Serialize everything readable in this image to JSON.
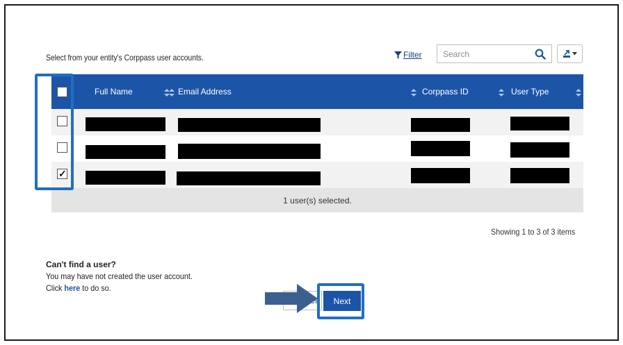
{
  "intro": {
    "prefix": "Select from your entity's",
    "brand": "Corppass",
    "suffix": "user accounts."
  },
  "toolbar": {
    "filter_label": "Filter",
    "search_placeholder": "Search",
    "search_value": "",
    "search_icon": "magnifier-icon",
    "export_icon": "export-icon",
    "dropdown_icon": "caret-down-icon"
  },
  "table": {
    "headers": {
      "full_name": "Full Name",
      "email": "Email Address",
      "corppass_id": "Corppass ID",
      "user_type": "User Type"
    },
    "rows": [
      {
        "checked": false,
        "full_name": "",
        "email": "",
        "corppass_id": "",
        "user_type": ""
      },
      {
        "checked": false,
        "full_name": "",
        "email": "",
        "corppass_id": "",
        "user_type": ""
      },
      {
        "checked": true,
        "full_name": "",
        "email": "",
        "corppass_id": "",
        "user_type": ""
      }
    ],
    "selection_summary": "1 user(s) selected."
  },
  "pagination": {
    "summary": "Showing 1 to 3 of 3 items"
  },
  "help": {
    "title": "Can't find a user?",
    "line1": "You may have not created the user account.",
    "line2_prefix": "Click",
    "link": "here",
    "line2_suffix": "to do so."
  },
  "actions": {
    "cancel_label": "Cancel",
    "cancel_visible": "el",
    "next_label": "Next"
  },
  "colors": {
    "header_bg": "#1c55a8",
    "highlight": "#1f6fc2",
    "arrow": "#3b5f8f",
    "footer_bg": "#e4e4e4"
  }
}
